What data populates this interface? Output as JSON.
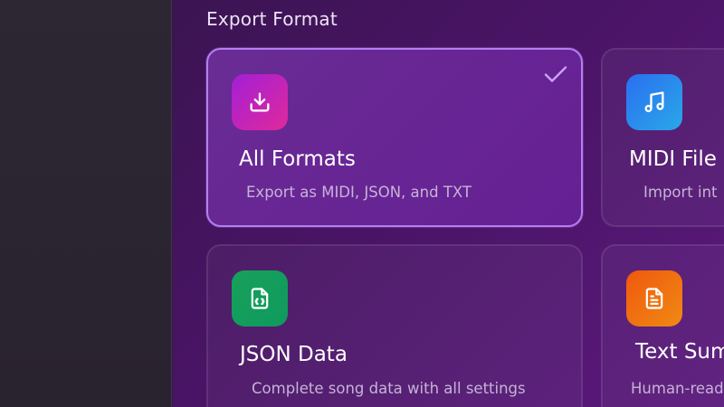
{
  "section": {
    "title": "Export Format"
  },
  "cards": [
    {
      "title": "All Formats",
      "description": "Export as MIDI, JSON, and TXT",
      "icon": "download-icon",
      "selected": true
    },
    {
      "title": "MIDI File",
      "description": "Import int",
      "icon": "music-note-icon",
      "selected": false
    },
    {
      "title": "JSON Data",
      "description": "Complete song data with all settings",
      "icon": "json-file-icon",
      "selected": false
    },
    {
      "title": "Text Sum",
      "description": "Human-read",
      "icon": "text-file-icon",
      "selected": false
    }
  ],
  "colors": {
    "accent": "#b57ef0",
    "tile_magenta": "#c724b8",
    "tile_blue": "#2a8cec",
    "tile_green": "#149e5c",
    "tile_orange": "#f07012"
  }
}
